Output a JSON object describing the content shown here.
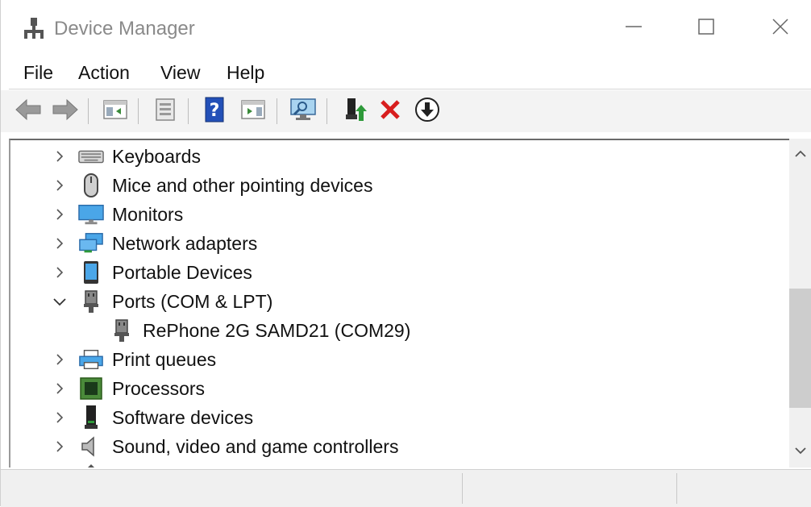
{
  "window": {
    "title": "Device Manager",
    "icon": "device-manager-icon",
    "controls": [
      "minimize-icon",
      "maximize-icon",
      "close-icon"
    ]
  },
  "menu": {
    "file": "File",
    "action": "Action",
    "view": "View",
    "help": "Help"
  },
  "toolbar": {
    "buttons": [
      "back-arrow-icon",
      "forward-arrow-icon",
      "show-hide-console-tree-icon",
      "properties-icon",
      "help-icon",
      "show-action-pane-icon",
      "scan-hardware-changes-icon",
      "update-driver-icon",
      "uninstall-device-icon",
      "disable-device-icon"
    ]
  },
  "tree": {
    "items": [
      {
        "label": "Keyboards",
        "expanded": false,
        "icon": "keyboard-icon"
      },
      {
        "label": "Mice and other pointing devices",
        "expanded": false,
        "icon": "mouse-icon"
      },
      {
        "label": "Monitors",
        "expanded": false,
        "icon": "monitor-icon"
      },
      {
        "label": "Network adapters",
        "expanded": false,
        "icon": "network-adapter-icon"
      },
      {
        "label": "Portable Devices",
        "expanded": false,
        "icon": "portable-device-icon"
      },
      {
        "label": "Ports (COM & LPT)",
        "expanded": true,
        "icon": "port-icon"
      },
      {
        "label": "RePhone 2G SAMD21 (COM29)",
        "child": true,
        "icon": "port-icon"
      },
      {
        "label": "Print queues",
        "expanded": false,
        "icon": "printer-icon"
      },
      {
        "label": "Processors",
        "expanded": false,
        "icon": "processor-icon"
      },
      {
        "label": "Software devices",
        "expanded": false,
        "icon": "software-device-icon"
      },
      {
        "label": "Sound, video and game controllers",
        "expanded": false,
        "icon": "speaker-icon"
      }
    ]
  },
  "colors": {
    "accent_blue": "#1e78c8",
    "delete_red": "#d81e1e",
    "toolbar_bg": "#f3f3f3"
  }
}
